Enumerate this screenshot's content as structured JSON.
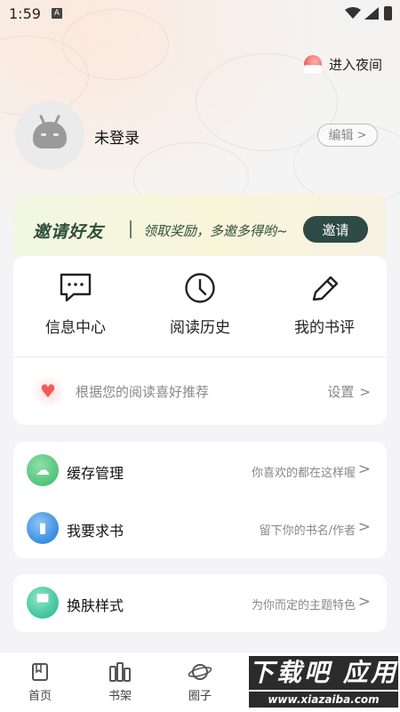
{
  "status_bar": {
    "time": "1:59",
    "notification_badge": "A"
  },
  "header": {
    "night_mode_label": "进入夜间"
  },
  "profile": {
    "name": "未登录",
    "edit_label": "编辑"
  },
  "invite_banner": {
    "title": "邀请好友",
    "subtitle": "领取奖励，多邀多得哟~",
    "button_label": "邀请"
  },
  "quick_actions": [
    {
      "label": "信息中心",
      "icon": "message-icon"
    },
    {
      "label": "阅读历史",
      "icon": "clock-icon"
    },
    {
      "label": "我的书评",
      "icon": "pencil-icon"
    }
  ],
  "recommend": {
    "text": "根据您的阅读喜好推荐",
    "setting_label": "设置"
  },
  "menu_rows": [
    {
      "label": "缓存管理",
      "hint": "你喜欢的都在这样喔",
      "icon": "cloud-download-icon",
      "color": "#52c47a"
    },
    {
      "label": "我要求书",
      "hint": "留下你的书名/作者",
      "icon": "book-icon",
      "color": "#3a8de0"
    }
  ],
  "skin_row": {
    "label": "换肤样式",
    "hint": "为你而定的主题特色",
    "icon": "shirt-icon",
    "color": "#3ec39a"
  },
  "bottom_nav": [
    {
      "label": "首页",
      "icon": "home-icon"
    },
    {
      "label": "书架",
      "icon": "bookshelf-icon"
    },
    {
      "label": "圈子",
      "icon": "planet-icon"
    }
  ],
  "watermark": {
    "text": "下载吧 应用",
    "url": "www.xiazaiba.com"
  }
}
